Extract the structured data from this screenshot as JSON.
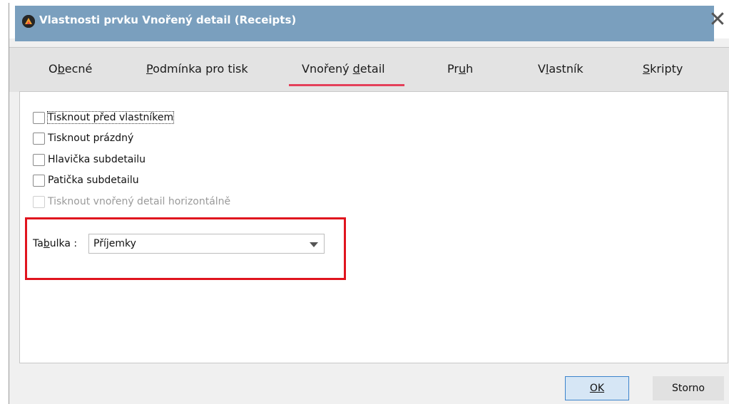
{
  "window": {
    "title": "Vlastnosti prvku Vnořený detail (Receipts)",
    "close_glyph": "✕",
    "title_bar_color": "#7a9fbe"
  },
  "tabs": [
    {
      "label_pre": "O",
      "label_ul": "b",
      "label_post": "ecné"
    },
    {
      "label_pre": "",
      "label_ul": "P",
      "label_post": "odmínka pro tisk"
    },
    {
      "label_pre": "Vnořený ",
      "label_ul": "d",
      "label_post": "etail"
    },
    {
      "label_pre": "Pr",
      "label_ul": "u",
      "label_post": "h"
    },
    {
      "label_pre": "V",
      "label_ul": "l",
      "label_post": "astník"
    },
    {
      "label_pre": "",
      "label_ul": "S",
      "label_post": "kripty"
    }
  ],
  "active_tab_color": "#e4405a",
  "checkboxes": [
    {
      "label": "Tisknout před vlastníkem",
      "checked": false
    },
    {
      "label": "Tisknout prázdný",
      "checked": false
    },
    {
      "label": "Hlavička subdetailu",
      "checked": false
    },
    {
      "label": "Patička subdetailu",
      "checked": false
    },
    {
      "label": "Tisknout vnořený detail horizontálně",
      "checked": false,
      "disabled": true
    }
  ],
  "table_field": {
    "label_pre": "Ta",
    "label_ul": "b",
    "label_post": "ulka :",
    "value": "Příjemky"
  },
  "highlight_color": "#e0141e",
  "buttons": {
    "ok": "OK",
    "cancel": "Storno"
  }
}
